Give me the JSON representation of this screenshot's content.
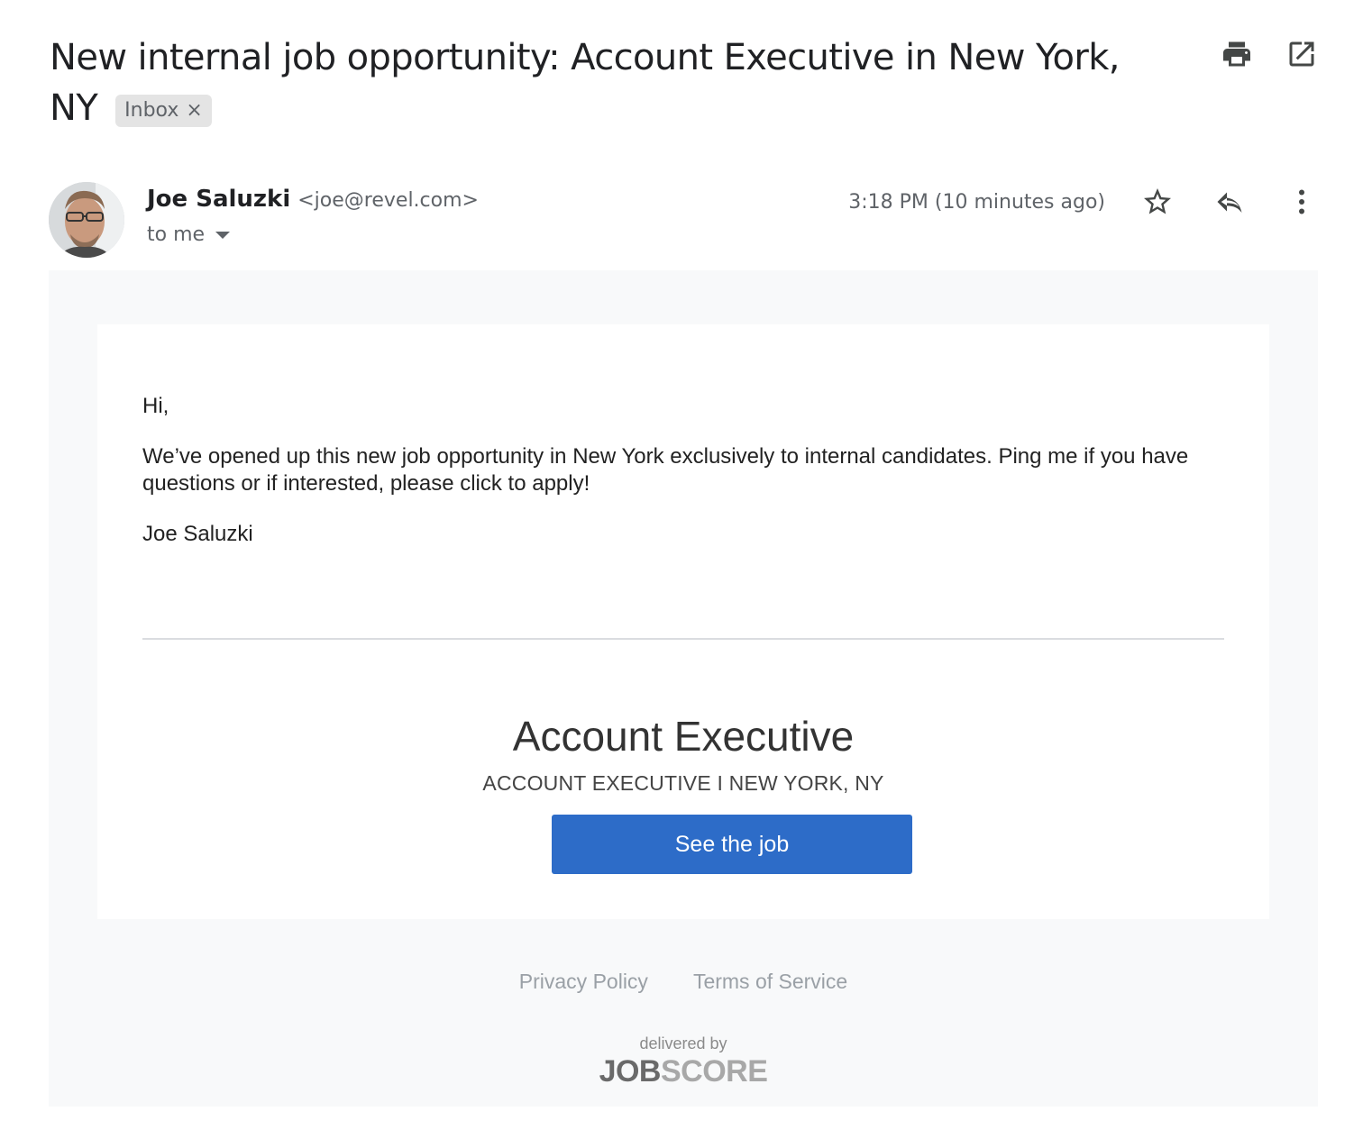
{
  "subject": {
    "text": "New internal job opportunity: Account Executive in New York, NY",
    "label_chip": "Inbox",
    "label_remove": "×"
  },
  "toolbar": {
    "print_icon": "print-icon",
    "open_in_new_icon": "open-in-new-icon"
  },
  "sender": {
    "name": "Joe Saluzki",
    "email": "<joe@revel.com>",
    "to": "to me",
    "timestamp": "3:18 PM (10 minutes ago)"
  },
  "actions": {
    "star_icon": "star-icon",
    "reply_icon": "reply-icon",
    "more_icon": "more-vert-icon"
  },
  "message": {
    "greeting": "Hi,",
    "body": "We’ve opened up this new job opportunity in New York exclusively to internal candidates. Ping me if you have questions or if interested, please click to apply!",
    "signature": "Joe Saluzki"
  },
  "job": {
    "title": "Account Executive",
    "subtitle": "ACCOUNT EXECUTIVE I NEW YORK, NY",
    "cta_label": "See the job",
    "cta_color": "#2d6cc8"
  },
  "footer": {
    "privacy": "Privacy Policy",
    "terms": "Terms of Service",
    "delivered_by": "delivered by",
    "brand_part1": "JOB",
    "brand_part2": "SCORE"
  }
}
